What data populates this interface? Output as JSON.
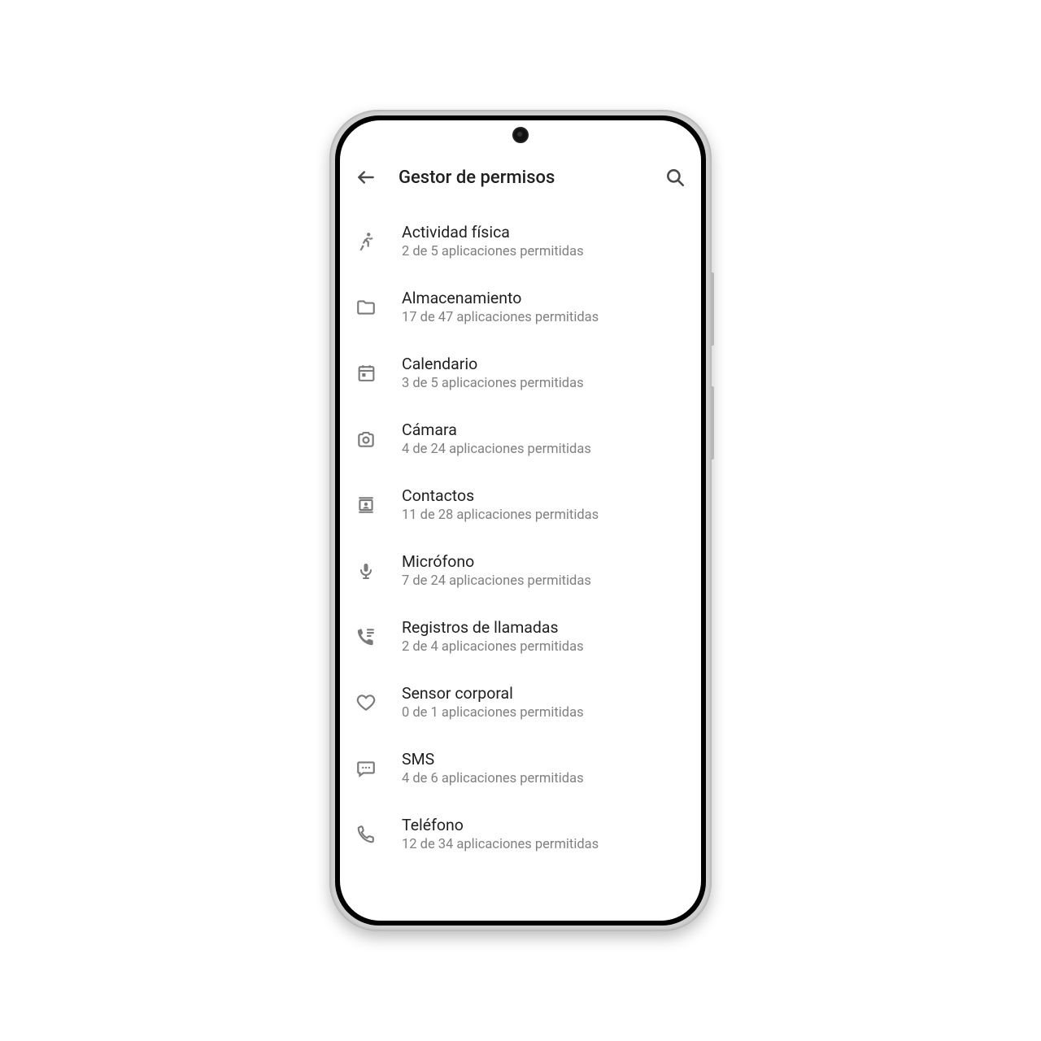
{
  "header": {
    "title": "Gestor de permisos"
  },
  "permissions": [
    {
      "label": "Actividad física",
      "subtitle": "2 de 5 aplicaciones permitidas",
      "icon": "run-icon"
    },
    {
      "label": "Almacenamiento",
      "subtitle": "17 de 47 aplicaciones permitidas",
      "icon": "folder-icon"
    },
    {
      "label": "Calendario",
      "subtitle": "3 de 5 aplicaciones permitidas",
      "icon": "calendar-icon"
    },
    {
      "label": "Cámara",
      "subtitle": "4 de 24 aplicaciones permitidas",
      "icon": "camera-icon"
    },
    {
      "label": "Contactos",
      "subtitle": "11 de 28 aplicaciones permitidas",
      "icon": "contacts-icon"
    },
    {
      "label": "Micrófono",
      "subtitle": "7 de 24 aplicaciones permitidas",
      "icon": "microphone-icon"
    },
    {
      "label": "Registros de llamadas",
      "subtitle": "2 de 4 aplicaciones permitidas",
      "icon": "call-log-icon"
    },
    {
      "label": "Sensor corporal",
      "subtitle": "0 de 1 aplicaciones permitidas",
      "icon": "heart-icon"
    },
    {
      "label": "SMS",
      "subtitle": "4 de 6 aplicaciones permitidas",
      "icon": "sms-icon"
    },
    {
      "label": "Teléfono",
      "subtitle": "12 de 34 aplicaciones permitidas",
      "icon": "phone-icon"
    }
  ]
}
